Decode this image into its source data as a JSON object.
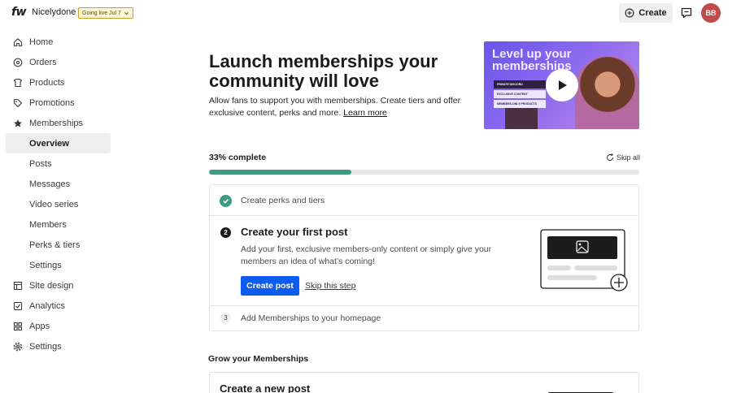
{
  "topbar": {
    "logo": "fw",
    "shop_name": "Nicelydone",
    "go_live": "Going live Jul 7",
    "create_label": "Create",
    "avatar_initials": "BB"
  },
  "sidebar": {
    "items": [
      {
        "label": "Home",
        "icon": "home-icon"
      },
      {
        "label": "Orders",
        "icon": "orders-icon"
      },
      {
        "label": "Products",
        "icon": "products-icon"
      },
      {
        "label": "Promotions",
        "icon": "tag-icon"
      },
      {
        "label": "Memberships",
        "icon": "star-icon"
      },
      {
        "label": "Overview",
        "sub": true,
        "active": true
      },
      {
        "label": "Posts",
        "sub": true
      },
      {
        "label": "Messages",
        "sub": true
      },
      {
        "label": "Video series",
        "sub": true
      },
      {
        "label": "Members",
        "sub": true
      },
      {
        "label": "Perks & tiers",
        "sub": true
      },
      {
        "label": "Settings",
        "sub": true
      },
      {
        "label": "Site design",
        "icon": "layout-icon"
      },
      {
        "label": "Analytics",
        "icon": "analytics-icon"
      },
      {
        "label": "Apps",
        "icon": "apps-icon"
      },
      {
        "label": "Settings",
        "icon": "gear-icon"
      }
    ]
  },
  "main": {
    "headline": "Launch memberships your community will love",
    "intro": "Allow fans to support you with memberships. Create tiers and offer exclusive content, perks and more.",
    "learn_more": "Learn more",
    "video": {
      "title": "Level up your memberships",
      "cards": [
        "PRIVATE DISCORD",
        "EXCLUSIVE CONTENT",
        "MEMBERS-ONLY PRODUCTS"
      ]
    },
    "progress": {
      "label": "33% complete",
      "value": 0.33,
      "skip_all": "Skip all"
    },
    "steps": {
      "step1": {
        "label": "Create perks and tiers",
        "done": true
      },
      "step2": {
        "number": "2",
        "title": "Create your first post",
        "description": "Add your first, exclusive members-only content or simply give your members an idea of what’s coming!",
        "primary": "Create post",
        "secondary": "Skip this step"
      },
      "step3": {
        "number": "3",
        "label": "Add Memberships to your homepage"
      }
    },
    "grow": {
      "title": "Grow your Memberships",
      "card_title": "Create a new post"
    }
  },
  "colors": {
    "accent": "#0d5cf0",
    "progress": "#3f9a82",
    "avatar": "#c14b4b",
    "badge_bg": "#fff6d6"
  }
}
